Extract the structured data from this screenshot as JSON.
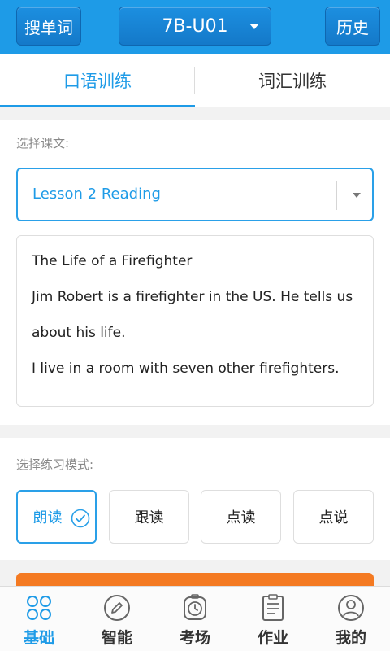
{
  "header": {
    "search_label": "搜单词",
    "unit_label": "7B-U01",
    "history_label": "历史"
  },
  "tabs": [
    {
      "label": "口语训练",
      "active": true
    },
    {
      "label": "词汇训练",
      "active": false
    }
  ],
  "lesson": {
    "section_label": "选择课文:",
    "selected": "Lesson 2 Reading",
    "text_lines": [
      "The Life of a Firefighter",
      "Jim Robert is a firefighter in the US. He tells us",
      "about his life.",
      "I live in a room with seven other firefighters."
    ]
  },
  "mode": {
    "section_label": "选择练习模式:",
    "options": [
      {
        "label": "朗读",
        "selected": true
      },
      {
        "label": "跟读",
        "selected": false
      },
      {
        "label": "点读",
        "selected": false
      },
      {
        "label": "点说",
        "selected": false
      }
    ]
  },
  "bottom_nav": [
    {
      "label": "基础",
      "icon": "clover-icon",
      "active": true
    },
    {
      "label": "智能",
      "icon": "pencil-icon",
      "active": false
    },
    {
      "label": "考场",
      "icon": "clock-icon",
      "active": false
    },
    {
      "label": "作业",
      "icon": "clipboard-icon",
      "active": false
    },
    {
      "label": "我的",
      "icon": "user-icon",
      "active": false
    }
  ],
  "colors": {
    "primary": "#1e9be7",
    "accent": "#f47a22"
  }
}
